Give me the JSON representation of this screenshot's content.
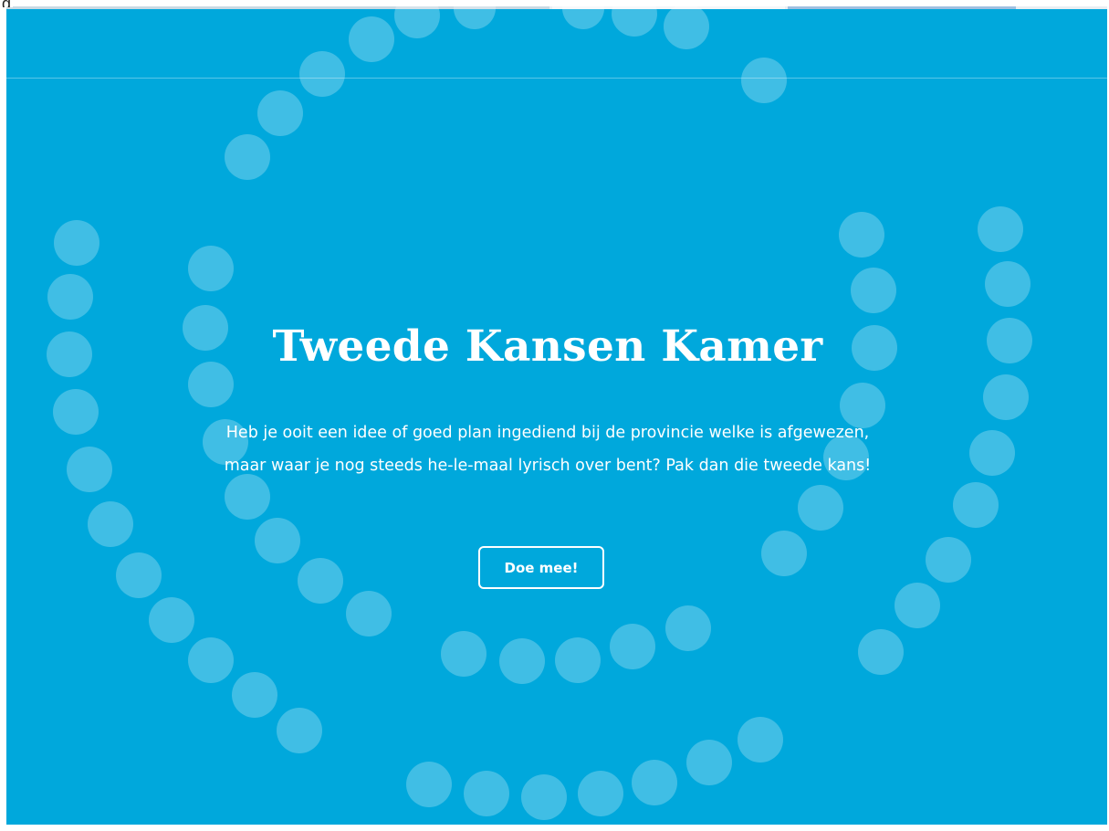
{
  "page_label": "g",
  "hero": {
    "title": "Tweede Kansen Kamer",
    "description": "Heb je ooit een idee of goed plan ingediend bij de provincie welke is afgewezen, maar waar je nog steeds he-le-maal lyrisch over bent? Pak dan die tweede kans!",
    "button_label": "Doe mee!"
  },
  "colors": {
    "background": "#00a8dc",
    "text": "#ffffff",
    "dot": "rgba(255,255,255,0.25)"
  }
}
